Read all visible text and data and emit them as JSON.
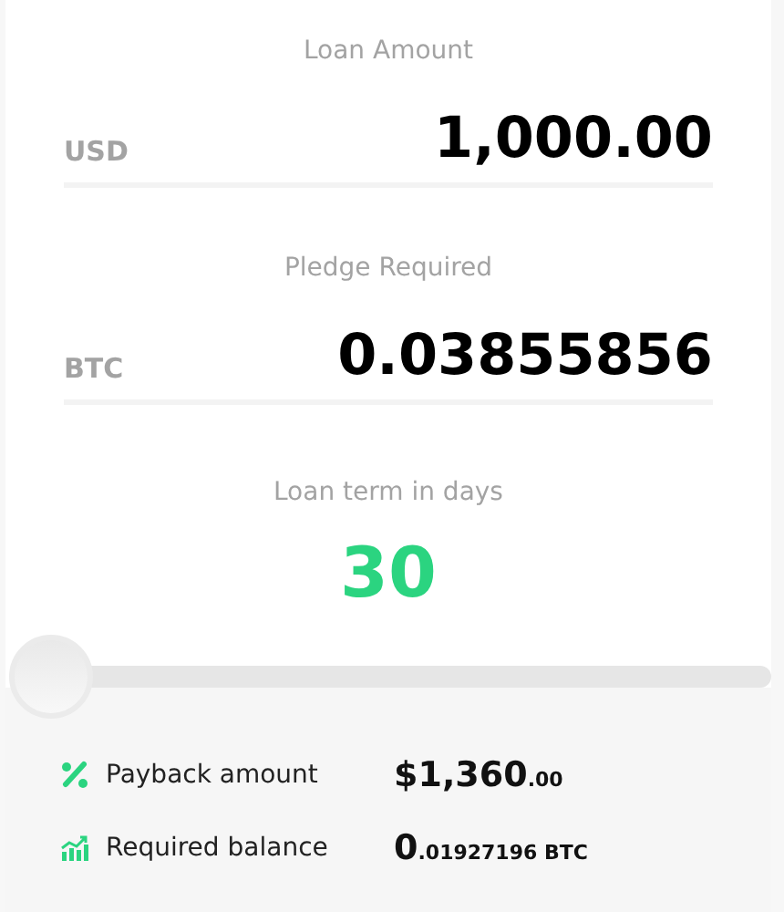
{
  "fields": [
    {
      "label": "Loan Amount",
      "currency": "USD",
      "value": "1,000.00"
    },
    {
      "label": "Pledge Required",
      "currency": "BTC",
      "value": "0.03855856"
    }
  ],
  "term": {
    "label": "Loan term in days",
    "value": "30",
    "slider": {
      "level": 0
    }
  },
  "summary": [
    {
      "kind": "percent",
      "label": "Payback amount",
      "value_main": "$1,360",
      "value_fraction": ".00"
    },
    {
      "kind": "chart",
      "label": "Required balance",
      "value_main": "0",
      "value_fraction": ".01927196 BTC"
    }
  ]
}
